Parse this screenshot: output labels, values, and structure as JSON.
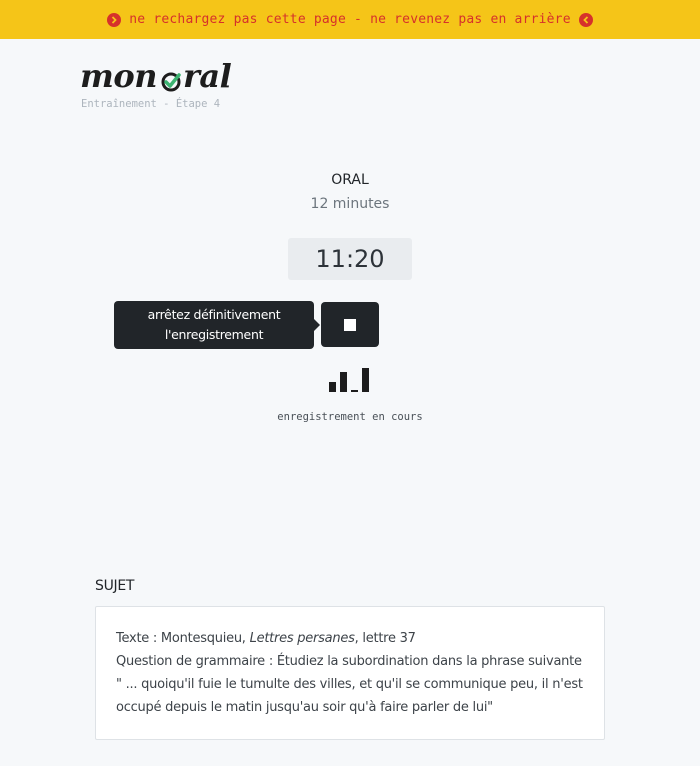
{
  "warning": {
    "text": "ne rechargez pas cette page - ne revenez pas en arrière",
    "left_icon": "chevron-circle-right-icon",
    "right_icon": "chevron-circle-left-icon"
  },
  "brand": {
    "logo_prefix": "mon ",
    "logo_o_icon": "green-check-icon",
    "logo_suffix": "ral",
    "subtitle": "Entraînement - Étape 4"
  },
  "exam": {
    "title": "ORAL",
    "duration": "12 minutes",
    "timer": "11:20"
  },
  "recording": {
    "tooltip_line1": "arrêtez définitivement",
    "tooltip_line2": "l'enregistrement",
    "stop_icon": "stop-square-icon",
    "level_icon": "audio-level-bars-icon",
    "status": "enregistrement en cours"
  },
  "sujet": {
    "heading": "SUJET",
    "text_prefix": "Texte : Montesquieu, ",
    "text_work": "Lettres persanes",
    "text_suffix": ", lettre 37",
    "question": "Question de grammaire : Étudiez la subordination dans la phrase suivante \" ... quoiqu'il fuie le tumulte des villes, et qu'il se communique peu, il n'est occupé depuis le matin jusqu'au soir qu'à faire parler de lui\""
  },
  "colors": {
    "warning_bg": "#f5c518",
    "warning_text": "#d6312b",
    "check_green": "#3cb371",
    "dark": "#212529",
    "page_bg": "#f6f8fa"
  }
}
